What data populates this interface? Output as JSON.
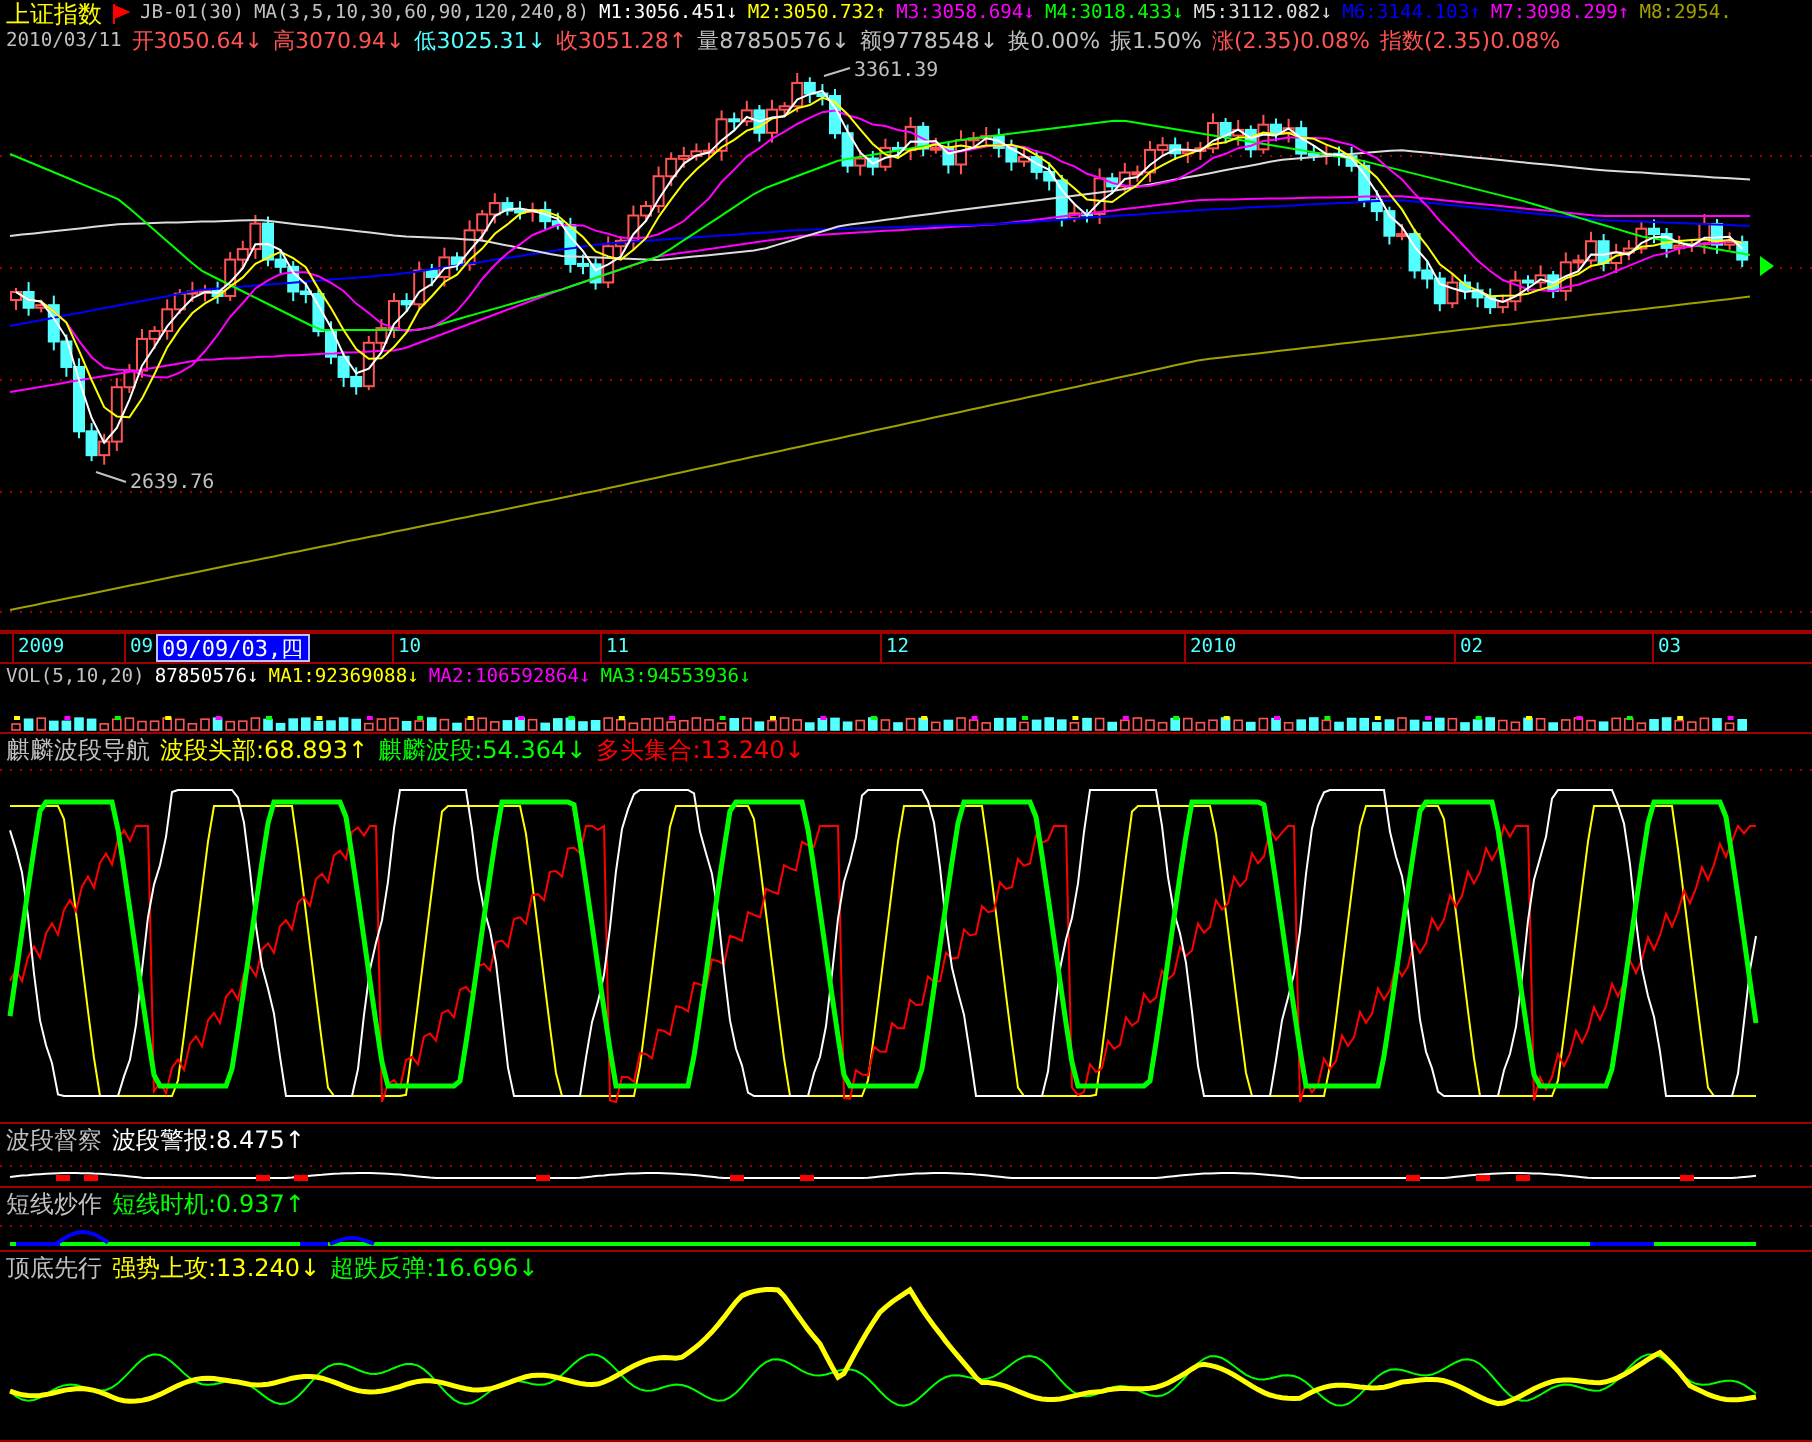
{
  "main_chart": {
    "title": "上证指数",
    "legend": [
      {
        "text": "JB-01(30)",
        "color": "#c0c0c0"
      },
      {
        "text": "MA(3,5,10,30,60,90,120,240,8)",
        "color": "#c0c0c0"
      },
      {
        "text": "M1:3056.451↓",
        "color": "#ffffff"
      },
      {
        "text": "M2:3050.732↑",
        "color": "#ffff00"
      },
      {
        "text": "M3:3058.694↓",
        "color": "#ff00ff"
      },
      {
        "text": "M4:3018.433↓",
        "color": "#00ff00"
      },
      {
        "text": "M5:3112.082↓",
        "color": "#dcdcdc"
      },
      {
        "text": "M6:3144.103↑",
        "color": "#0000ff"
      },
      {
        "text": "M7:3098.299↑",
        "color": "#ff00ff"
      },
      {
        "text": "M8:2954.",
        "color": "#a0a000"
      }
    ],
    "date": "2010/03/11",
    "quote": [
      {
        "text": "开3050.64↓",
        "color": "#ff5454"
      },
      {
        "text": "高3070.94↓",
        "color": "#ff5454"
      },
      {
        "text": "低3025.31↓",
        "color": "#54ffff"
      },
      {
        "text": "收3051.28↑",
        "color": "#ff5454"
      },
      {
        "text": "量87850576↓",
        "color": "#c0c0c0"
      },
      {
        "text": "额9778548↓",
        "color": "#c0c0c0"
      },
      {
        "text": "换0.00%",
        "color": "#c0c0c0"
      },
      {
        "text": "振1.50%",
        "color": "#c0c0c0"
      },
      {
        "text": "涨(2.35)0.08%",
        "color": "#ff5454"
      },
      {
        "text": "指数(2.35)0.08%",
        "color": "#ff5454"
      }
    ],
    "high_label": "3361.39",
    "low_label": "2639.76"
  },
  "time_axis": {
    "labels": [
      {
        "text": "2009",
        "selected": false
      },
      {
        "text": "09",
        "selected": false
      },
      {
        "text": "09/09/03,四",
        "selected": true
      },
      {
        "text": "10",
        "selected": false
      },
      {
        "text": "11",
        "selected": false
      },
      {
        "text": "12",
        "selected": false
      },
      {
        "text": "2010",
        "selected": false
      },
      {
        "text": "02",
        "selected": false
      },
      {
        "text": "03",
        "selected": false
      }
    ]
  },
  "volume_panel": {
    "legend": [
      {
        "text": "VOL(5,10,20)",
        "color": "#c0c0c0"
      },
      {
        "text": "87850576↓",
        "color": "#ffffff"
      },
      {
        "text": "MA1:92369088↓",
        "color": "#ffff00"
      },
      {
        "text": "MA2:106592864↓",
        "color": "#ff00ff"
      },
      {
        "text": "MA3:94553936↓",
        "color": "#00ff00"
      }
    ]
  },
  "indicators": [
    {
      "title": "麒麟波段导航",
      "legend": [
        {
          "text": "波段头部:68.893↑",
          "color": "#ffff00"
        },
        {
          "text": "麒麟波段:54.364↓",
          "color": "#00ff00"
        },
        {
          "text": "多头集合:13.240↓",
          "color": "#ff0000"
        }
      ]
    },
    {
      "title": "波段督察",
      "legend": [
        {
          "text": "波段警报:8.475↑",
          "color": "#ffffff"
        }
      ]
    },
    {
      "title": "短线炒作",
      "legend": [
        {
          "text": "短线时机:0.937↑",
          "color": "#00ff00"
        }
      ]
    },
    {
      "title": "顶底先行",
      "legend": [
        {
          "text": "强势上攻:13.240↓",
          "color": "#ffff00"
        },
        {
          "text": "超跌反弹:16.696↓",
          "color": "#00ff00"
        }
      ]
    }
  ]
}
